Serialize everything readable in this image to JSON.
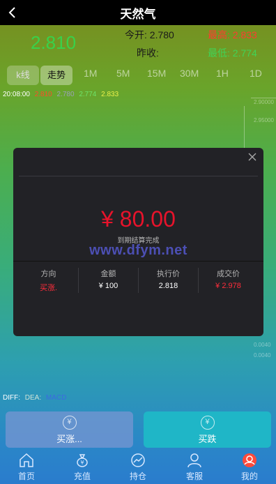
{
  "header": {
    "title": "天然气"
  },
  "quote": {
    "price": "2.810",
    "open_label": "今开:",
    "open_value": "2.780",
    "high_label": "最高:",
    "high_value": "2.833",
    "prev_label": "昨收:",
    "prev_value": "",
    "low_label": "最低:",
    "low_value": "2.774"
  },
  "tabs": [
    "k线",
    "走势",
    "1M",
    "5M",
    "15M",
    "30M",
    "1H",
    "1D"
  ],
  "ohlc": {
    "time": "20:08:00",
    "v1": "2.810",
    "v2": "2.780",
    "v3": "2.774",
    "v4": "2.833"
  },
  "axis": [
    "2.90000",
    "2.95000",
    "0.0040",
    "0.0040"
  ],
  "indicators": {
    "diff": "DIFF:",
    "dea": "DEA:",
    "macd": "MACD"
  },
  "modal": {
    "amount": "¥ 80.00",
    "status": "到期结算完成",
    "watermark": "www.dfym.net",
    "columns": [
      {
        "header": "方向",
        "value": "买涨."
      },
      {
        "header": "金额",
        "value": "¥ 100"
      },
      {
        "header": "执行价",
        "value": "2.818"
      },
      {
        "header": "成交价",
        "value": "¥ 2.978"
      }
    ]
  },
  "actions": {
    "buy_up": "买涨...",
    "buy_down": "买跌"
  },
  "nav": [
    "首页",
    "充值",
    "持仓",
    "客服",
    "我的"
  ],
  "colors": {
    "up": "#ff2d3b",
    "down": "#41d356",
    "accent": "#1fb6c7"
  }
}
